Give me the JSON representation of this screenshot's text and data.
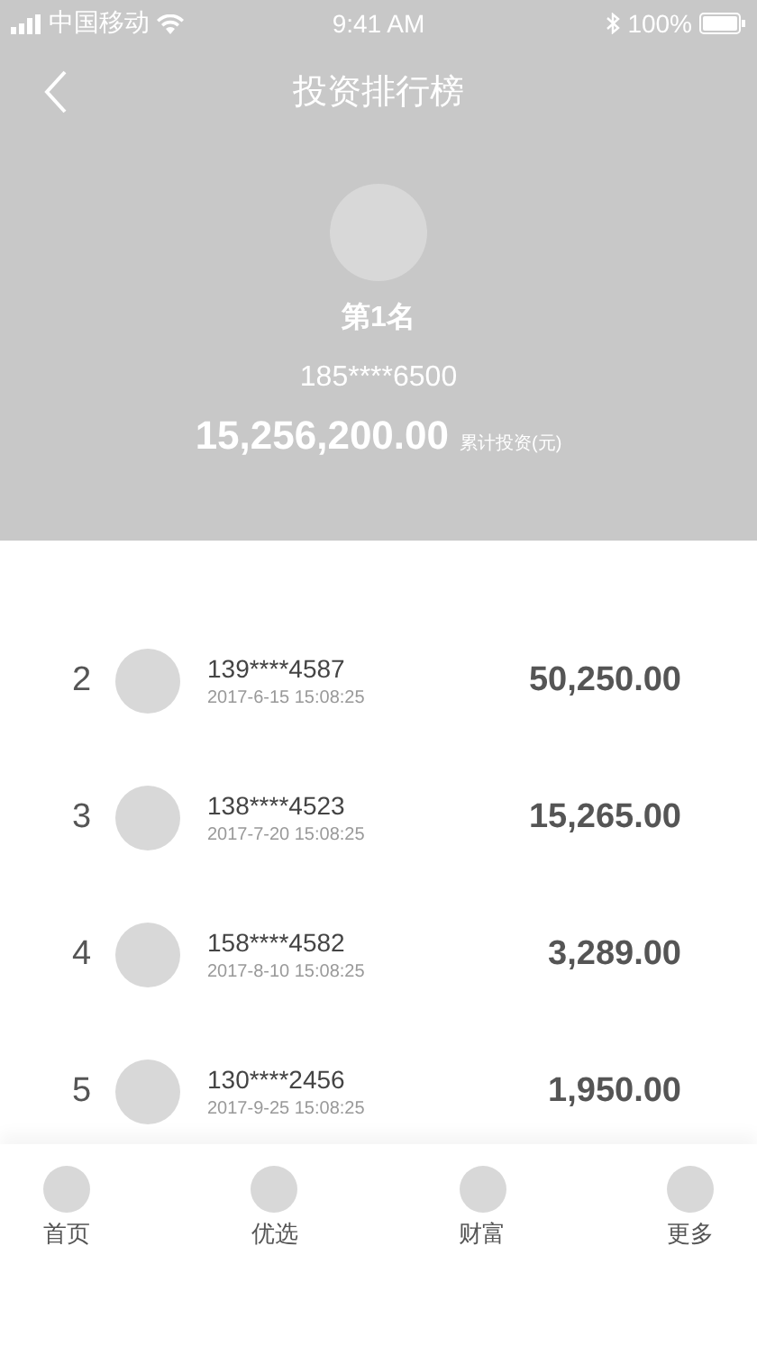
{
  "status_bar": {
    "carrier": "中国移动",
    "time": "9:41 AM",
    "battery": "100%"
  },
  "nav": {
    "title": "投资排行榜"
  },
  "top": {
    "rank": "第1名",
    "phone": "185****6500",
    "amount": "15,256,200.00",
    "amount_label": "累计投资(元)"
  },
  "rows": [
    {
      "rank": "2",
      "phone": "139****4587",
      "time": "2017-6-15 15:08:25",
      "amount": "50,250.00"
    },
    {
      "rank": "3",
      "phone": "138****4523",
      "time": "2017-7-20 15:08:25",
      "amount": "15,265.00"
    },
    {
      "rank": "4",
      "phone": "158****4582",
      "time": "2017-8-10 15:08:25",
      "amount": "3,289.00"
    },
    {
      "rank": "5",
      "phone": "130****2456",
      "time": "2017-9-25 15:08:25",
      "amount": "1,950.00"
    }
  ],
  "tab_bar": [
    {
      "label": "首页"
    },
    {
      "label": "优选"
    },
    {
      "label": "财富"
    },
    {
      "label": "更多"
    }
  ]
}
